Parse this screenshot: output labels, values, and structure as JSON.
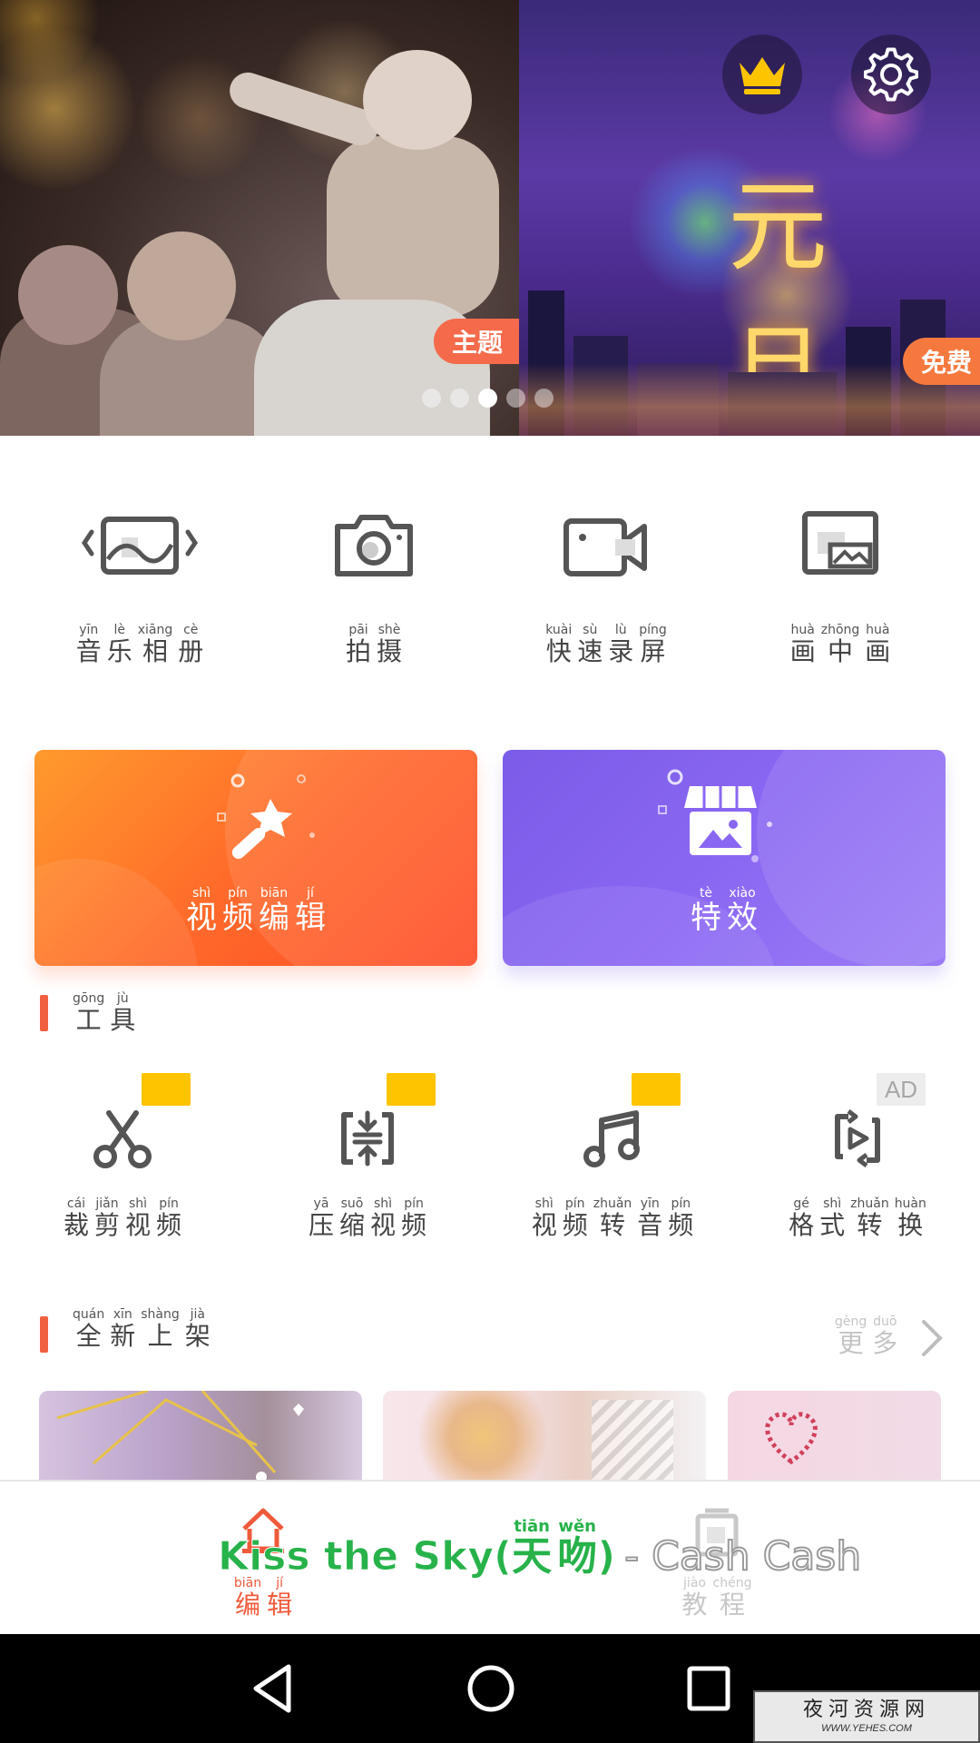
{
  "banner": {
    "left_tag": "主题",
    "right_tag": "免费",
    "right_slide_text": "元旦",
    "page_count": 5,
    "active_page": 3
  },
  "quick_actions": [
    {
      "icon": "image-slideshow-icon",
      "chars": [
        {
          "py": "yīn",
          "hz": "音"
        },
        {
          "py": "lè",
          "hz": "乐"
        },
        {
          "py": "xiāng",
          "hz": "相"
        },
        {
          "py": "cè",
          "hz": "册"
        }
      ]
    },
    {
      "icon": "camera-icon",
      "chars": [
        {
          "py": "pāi",
          "hz": "拍"
        },
        {
          "py": "shè",
          "hz": "摄"
        }
      ]
    },
    {
      "icon": "video-camera-icon",
      "chars": [
        {
          "py": "kuài",
          "hz": "快"
        },
        {
          "py": "sù",
          "hz": "速"
        },
        {
          "py": "lù",
          "hz": "录"
        },
        {
          "py": "píng",
          "hz": "屏"
        }
      ]
    },
    {
      "icon": "picture-in-picture-icon",
      "chars": [
        {
          "py": "huà",
          "hz": "画"
        },
        {
          "py": "zhōng",
          "hz": "中"
        },
        {
          "py": "huà",
          "hz": "画"
        }
      ]
    }
  ],
  "cards": {
    "edit": {
      "icon": "magic-wand-icon",
      "chars": [
        {
          "py": "shì",
          "hz": "视"
        },
        {
          "py": "pín",
          "hz": "频"
        },
        {
          "py": "biān",
          "hz": "编"
        },
        {
          "py": "jí",
          "hz": "辑"
        }
      ]
    },
    "effects": {
      "icon": "store-icon",
      "chars": [
        {
          "py": "tè",
          "hz": "特"
        },
        {
          "py": "xiào",
          "hz": "效"
        }
      ]
    }
  },
  "tools_section": {
    "chars": [
      {
        "py": "gōng",
        "hz": "工"
      },
      {
        "py": "jù",
        "hz": "具"
      }
    ]
  },
  "tools": [
    {
      "icon": "scissors-icon",
      "badge": "crown",
      "chars": [
        {
          "py": "cái",
          "hz": "裁"
        },
        {
          "py": "jiǎn",
          "hz": "剪"
        },
        {
          "py": "shì",
          "hz": "视"
        },
        {
          "py": "pín",
          "hz": "频"
        }
      ]
    },
    {
      "icon": "compress-icon",
      "badge": "crown",
      "chars": [
        {
          "py": "yā",
          "hz": "压"
        },
        {
          "py": "suō",
          "hz": "缩"
        },
        {
          "py": "shì",
          "hz": "视"
        },
        {
          "py": "pín",
          "hz": "频"
        }
      ]
    },
    {
      "icon": "music-note-icon",
      "badge": "crown",
      "chars": [
        {
          "py": "shì",
          "hz": "视"
        },
        {
          "py": "pín",
          "hz": "频"
        },
        {
          "py": "zhuǎn",
          "hz": "转"
        },
        {
          "py": "yīn",
          "hz": "音"
        },
        {
          "py": "pín",
          "hz": "频"
        }
      ]
    },
    {
      "icon": "convert-icon",
      "badge": "AD",
      "chars": [
        {
          "py": "gé",
          "hz": "格"
        },
        {
          "py": "shì",
          "hz": "式"
        },
        {
          "py": "zhuǎn",
          "hz": "转"
        },
        {
          "py": "huàn",
          "hz": "换"
        }
      ]
    }
  ],
  "new_section": {
    "chars": [
      {
        "py": "quán",
        "hz": "全"
      },
      {
        "py": "xīn",
        "hz": "新"
      },
      {
        "py": "shàng",
        "hz": "上"
      },
      {
        "py": "jià",
        "hz": "架"
      }
    ],
    "more_chars": [
      {
        "py": "gèng",
        "hz": "更"
      },
      {
        "py": "duō",
        "hz": "多"
      }
    ]
  },
  "bottom_nav": {
    "edit": {
      "icon": "home-edit-icon",
      "chars": [
        {
          "py": "biān",
          "hz": "编"
        },
        {
          "py": "jí",
          "hz": "辑"
        }
      ]
    },
    "tutorial": {
      "icon": "tutorial-icon",
      "chars": [
        {
          "py": "jiào",
          "hz": "教"
        },
        {
          "py": "chéng",
          "hz": "程"
        }
      ]
    }
  },
  "lyric": {
    "part1": "Kiss the Sky",
    "paren_open": "(",
    "chars": [
      {
        "py": "tiān",
        "hz": "天"
      },
      {
        "py": "wěn",
        "hz": "吻"
      }
    ],
    "paren_close": ")",
    "part2": "- Cash Cash"
  },
  "watermark": {
    "line1": "夜河资源网",
    "line2": "WWW.YEHES.COM"
  },
  "colors": {
    "accent": "#f06040",
    "orange_card": "#ff6a2a",
    "purple_card": "#8a67f2",
    "crown": "#ffc400",
    "lyric_green": "#27b24a"
  }
}
